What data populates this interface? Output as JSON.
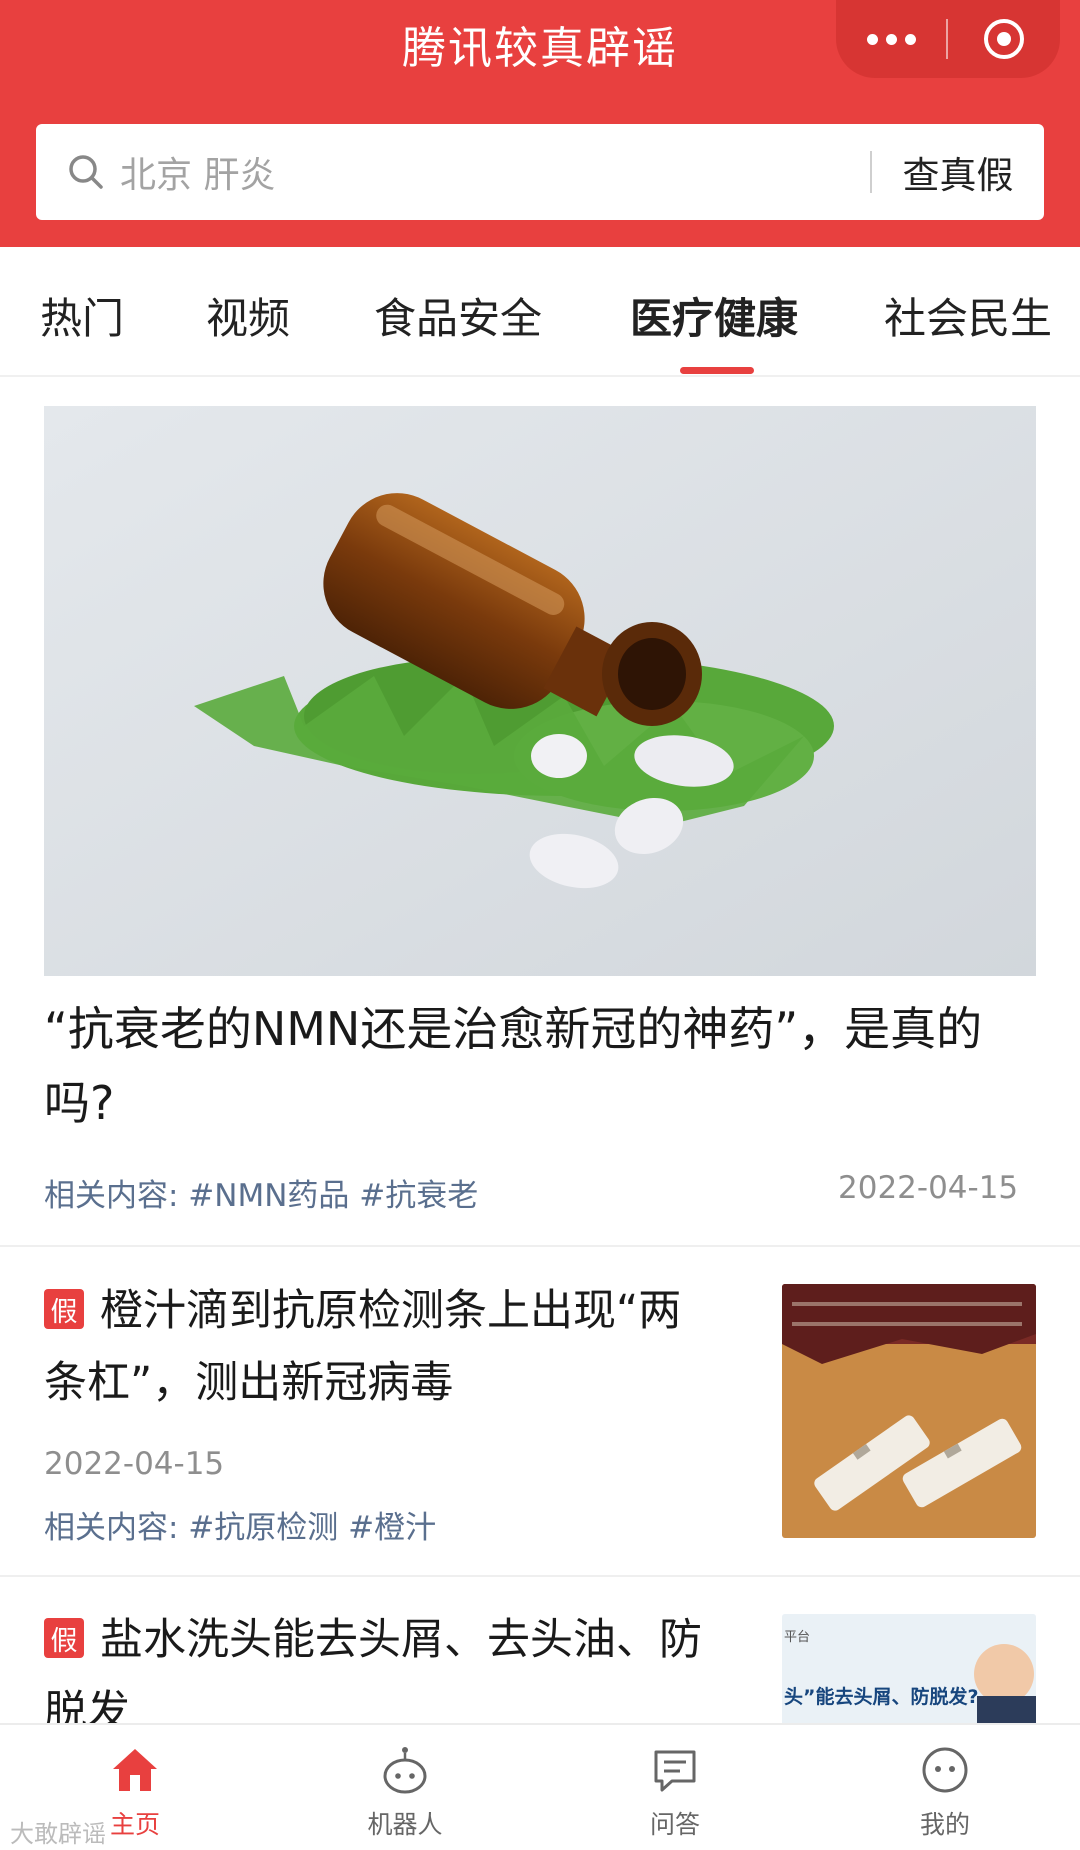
{
  "header": {
    "title": "腾讯较真辟谣",
    "accent_color": "#e8403f",
    "menu_icons": [
      "more-dots-icon",
      "target-circle-icon"
    ]
  },
  "search": {
    "placeholder": "北京 肝炎",
    "button": "查真假"
  },
  "tabs": [
    {
      "label": "热门",
      "active": false
    },
    {
      "label": "视频",
      "active": false
    },
    {
      "label": "食品安全",
      "active": false
    },
    {
      "label": "医疗健康",
      "active": true
    },
    {
      "label": "社会民生",
      "active": false
    }
  ],
  "feed": {
    "featured": {
      "title": "“抗衰老的NMN还是治愈新冠的神药”，是真的吗?",
      "tags": "相关内容: #NMN药品 #抗衰老",
      "date": "2022-04-15"
    },
    "items": [
      {
        "badge": "假",
        "title": "橙汁滴到抗原检测条上出现“两条杠”，测出新冠病毒",
        "date": "2022-04-15",
        "tags": "相关内容: #抗原检测 #橙汁"
      },
      {
        "badge": "假",
        "title": "盐水洗头能去头屑、去头油、防脱发",
        "thumb_caption": "头”能去头屑、防脱发?",
        "thumb_corner": "平台"
      }
    ]
  },
  "bottom_nav": [
    {
      "label": "主页",
      "icon": "home-icon",
      "active": true
    },
    {
      "label": "机器人",
      "icon": "robot-icon",
      "active": false
    },
    {
      "label": "问答",
      "icon": "chat-icon",
      "active": false
    },
    {
      "label": "我的",
      "icon": "profile-icon",
      "active": false
    }
  ],
  "watermark": "大敢辟谣"
}
